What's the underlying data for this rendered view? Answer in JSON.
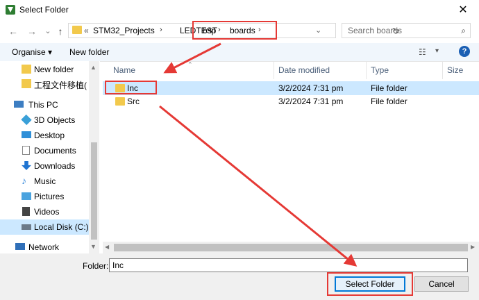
{
  "window": {
    "title": "Select Folder",
    "close_glyph": "✕"
  },
  "nav": {
    "back_glyph": "←",
    "forward_glyph": "→",
    "recent_glyph": "⌄",
    "up_glyph": "↑",
    "address": [
      "STM32_Projects",
      "LEDTEST",
      "bsp",
      "boards"
    ],
    "address_prefix": "«",
    "refresh_glyph": "↻",
    "search_placeholder": "Search boards",
    "search_glyph": "⌕"
  },
  "command_bar": {
    "organise": "Organise ▾",
    "new_folder": "New folder",
    "view_glyph": "☷",
    "view_caret": "▾",
    "help": "?"
  },
  "sidebar": {
    "items": [
      {
        "label": "New folder",
        "icon": "folder-icon",
        "color": "#f2c94c"
      },
      {
        "label": "工程文件移植(",
        "icon": "folder-icon",
        "color": "#f2c94c"
      },
      {
        "label": "This PC",
        "icon": "computer-icon",
        "color": "#3d7ec2"
      },
      {
        "label": "3D Objects",
        "icon": "cube-icon",
        "color": "#3aa0d8"
      },
      {
        "label": "Desktop",
        "icon": "desktop-icon",
        "color": "#2f8fd8"
      },
      {
        "label": "Documents",
        "icon": "document-icon",
        "color": "#8a8a8a"
      },
      {
        "label": "Downloads",
        "icon": "download-icon",
        "color": "#1f74d1"
      },
      {
        "label": "Music",
        "icon": "music-icon",
        "color": "#2b82d9"
      },
      {
        "label": "Pictures",
        "icon": "picture-icon",
        "color": "#4aa3df"
      },
      {
        "label": "Videos",
        "icon": "video-icon",
        "color": "#444444"
      },
      {
        "label": "Local Disk (C:)",
        "icon": "disk-icon",
        "color": "#6c7a89"
      },
      {
        "label": "Network",
        "icon": "network-icon",
        "color": "#2f6fb8"
      }
    ]
  },
  "columns": [
    "Name",
    "Date modified",
    "Type",
    "Size"
  ],
  "files": [
    {
      "name": "Inc",
      "date": "3/2/2024 7:31 pm",
      "type": "File folder"
    },
    {
      "name": "Src",
      "date": "3/2/2024 7:31 pm",
      "type": "File folder"
    }
  ],
  "footer": {
    "folder_label": "Folder:",
    "folder_value": "Inc",
    "select_button": "Select Folder",
    "cancel_button": "Cancel"
  },
  "colors": {
    "annotation_red": "#e53935",
    "selection": "#cce8ff",
    "accent": "#0078d7"
  }
}
